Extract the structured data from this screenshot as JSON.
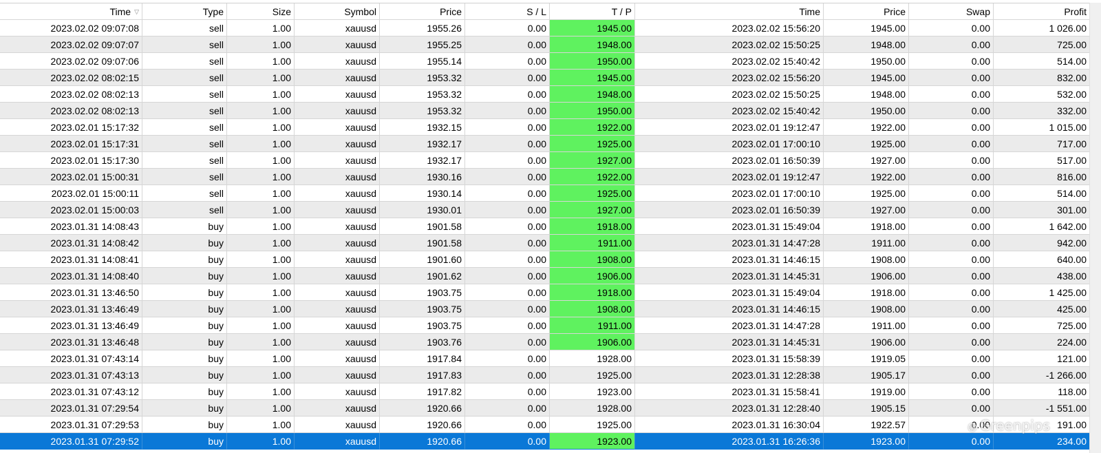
{
  "columns": [
    "Time",
    "Type",
    "Size",
    "Symbol",
    "Price",
    "S / L",
    "T / P",
    "Time",
    "Price",
    "Swap",
    "Profit"
  ],
  "sort_icon": "sort-descending-icon",
  "colors": {
    "tp_hit": "#5ff25f",
    "selected_row": "#0a78d7",
    "alt_row": "#ebebeb"
  },
  "watermark": {
    "icon": "wechat-icon",
    "text": "Greenpips"
  },
  "rows": [
    {
      "open_time": "2023.02.02 09:07:08",
      "type": "sell",
      "size": "1.00",
      "symbol": "xauusd",
      "price": "1955.26",
      "sl": "0.00",
      "tp": "1945.00",
      "tp_hit": true,
      "close_time": "2023.02.02 15:56:20",
      "close_price": "1945.00",
      "swap": "0.00",
      "profit": "1 026.00"
    },
    {
      "open_time": "2023.02.02 09:07:07",
      "type": "sell",
      "size": "1.00",
      "symbol": "xauusd",
      "price": "1955.25",
      "sl": "0.00",
      "tp": "1948.00",
      "tp_hit": true,
      "close_time": "2023.02.02 15:50:25",
      "close_price": "1948.00",
      "swap": "0.00",
      "profit": "725.00"
    },
    {
      "open_time": "2023.02.02 09:07:06",
      "type": "sell",
      "size": "1.00",
      "symbol": "xauusd",
      "price": "1955.14",
      "sl": "0.00",
      "tp": "1950.00",
      "tp_hit": true,
      "close_time": "2023.02.02 15:40:42",
      "close_price": "1950.00",
      "swap": "0.00",
      "profit": "514.00"
    },
    {
      "open_time": "2023.02.02 08:02:15",
      "type": "sell",
      "size": "1.00",
      "symbol": "xauusd",
      "price": "1953.32",
      "sl": "0.00",
      "tp": "1945.00",
      "tp_hit": true,
      "close_time": "2023.02.02 15:56:20",
      "close_price": "1945.00",
      "swap": "0.00",
      "profit": "832.00"
    },
    {
      "open_time": "2023.02.02 08:02:13",
      "type": "sell",
      "size": "1.00",
      "symbol": "xauusd",
      "price": "1953.32",
      "sl": "0.00",
      "tp": "1948.00",
      "tp_hit": true,
      "close_time": "2023.02.02 15:50:25",
      "close_price": "1948.00",
      "swap": "0.00",
      "profit": "532.00"
    },
    {
      "open_time": "2023.02.02 08:02:13",
      "type": "sell",
      "size": "1.00",
      "symbol": "xauusd",
      "price": "1953.32",
      "sl": "0.00",
      "tp": "1950.00",
      "tp_hit": true,
      "close_time": "2023.02.02 15:40:42",
      "close_price": "1950.00",
      "swap": "0.00",
      "profit": "332.00"
    },
    {
      "open_time": "2023.02.01 15:17:32",
      "type": "sell",
      "size": "1.00",
      "symbol": "xauusd",
      "price": "1932.15",
      "sl": "0.00",
      "tp": "1922.00",
      "tp_hit": true,
      "close_time": "2023.02.01 19:12:47",
      "close_price": "1922.00",
      "swap": "0.00",
      "profit": "1 015.00"
    },
    {
      "open_time": "2023.02.01 15:17:31",
      "type": "sell",
      "size": "1.00",
      "symbol": "xauusd",
      "price": "1932.17",
      "sl": "0.00",
      "tp": "1925.00",
      "tp_hit": true,
      "close_time": "2023.02.01 17:00:10",
      "close_price": "1925.00",
      "swap": "0.00",
      "profit": "717.00"
    },
    {
      "open_time": "2023.02.01 15:17:30",
      "type": "sell",
      "size": "1.00",
      "symbol": "xauusd",
      "price": "1932.17",
      "sl": "0.00",
      "tp": "1927.00",
      "tp_hit": true,
      "close_time": "2023.02.01 16:50:39",
      "close_price": "1927.00",
      "swap": "0.00",
      "profit": "517.00"
    },
    {
      "open_time": "2023.02.01 15:00:31",
      "type": "sell",
      "size": "1.00",
      "symbol": "xauusd",
      "price": "1930.16",
      "sl": "0.00",
      "tp": "1922.00",
      "tp_hit": true,
      "close_time": "2023.02.01 19:12:47",
      "close_price": "1922.00",
      "swap": "0.00",
      "profit": "816.00"
    },
    {
      "open_time": "2023.02.01 15:00:11",
      "type": "sell",
      "size": "1.00",
      "symbol": "xauusd",
      "price": "1930.14",
      "sl": "0.00",
      "tp": "1925.00",
      "tp_hit": true,
      "close_time": "2023.02.01 17:00:10",
      "close_price": "1925.00",
      "swap": "0.00",
      "profit": "514.00"
    },
    {
      "open_time": "2023.02.01 15:00:03",
      "type": "sell",
      "size": "1.00",
      "symbol": "xauusd",
      "price": "1930.01",
      "sl": "0.00",
      "tp": "1927.00",
      "tp_hit": true,
      "close_time": "2023.02.01 16:50:39",
      "close_price": "1927.00",
      "swap": "0.00",
      "profit": "301.00"
    },
    {
      "open_time": "2023.01.31 14:08:43",
      "type": "buy",
      "size": "1.00",
      "symbol": "xauusd",
      "price": "1901.58",
      "sl": "0.00",
      "tp": "1918.00",
      "tp_hit": true,
      "close_time": "2023.01.31 15:49:04",
      "close_price": "1918.00",
      "swap": "0.00",
      "profit": "1 642.00"
    },
    {
      "open_time": "2023.01.31 14:08:42",
      "type": "buy",
      "size": "1.00",
      "symbol": "xauusd",
      "price": "1901.58",
      "sl": "0.00",
      "tp": "1911.00",
      "tp_hit": true,
      "close_time": "2023.01.31 14:47:28",
      "close_price": "1911.00",
      "swap": "0.00",
      "profit": "942.00"
    },
    {
      "open_time": "2023.01.31 14:08:41",
      "type": "buy",
      "size": "1.00",
      "symbol": "xauusd",
      "price": "1901.60",
      "sl": "0.00",
      "tp": "1908.00",
      "tp_hit": true,
      "close_time": "2023.01.31 14:46:15",
      "close_price": "1908.00",
      "swap": "0.00",
      "profit": "640.00"
    },
    {
      "open_time": "2023.01.31 14:08:40",
      "type": "buy",
      "size": "1.00",
      "symbol": "xauusd",
      "price": "1901.62",
      "sl": "0.00",
      "tp": "1906.00",
      "tp_hit": true,
      "close_time": "2023.01.31 14:45:31",
      "close_price": "1906.00",
      "swap": "0.00",
      "profit": "438.00"
    },
    {
      "open_time": "2023.01.31 13:46:50",
      "type": "buy",
      "size": "1.00",
      "symbol": "xauusd",
      "price": "1903.75",
      "sl": "0.00",
      "tp": "1918.00",
      "tp_hit": true,
      "close_time": "2023.01.31 15:49:04",
      "close_price": "1918.00",
      "swap": "0.00",
      "profit": "1 425.00"
    },
    {
      "open_time": "2023.01.31 13:46:49",
      "type": "buy",
      "size": "1.00",
      "symbol": "xauusd",
      "price": "1903.75",
      "sl": "0.00",
      "tp": "1908.00",
      "tp_hit": true,
      "close_time": "2023.01.31 14:46:15",
      "close_price": "1908.00",
      "swap": "0.00",
      "profit": "425.00"
    },
    {
      "open_time": "2023.01.31 13:46:49",
      "type": "buy",
      "size": "1.00",
      "symbol": "xauusd",
      "price": "1903.75",
      "sl": "0.00",
      "tp": "1911.00",
      "tp_hit": true,
      "close_time": "2023.01.31 14:47:28",
      "close_price": "1911.00",
      "swap": "0.00",
      "profit": "725.00"
    },
    {
      "open_time": "2023.01.31 13:46:48",
      "type": "buy",
      "size": "1.00",
      "symbol": "xauusd",
      "price": "1903.76",
      "sl": "0.00",
      "tp": "1906.00",
      "tp_hit": true,
      "close_time": "2023.01.31 14:45:31",
      "close_price": "1906.00",
      "swap": "0.00",
      "profit": "224.00"
    },
    {
      "open_time": "2023.01.31 07:43:14",
      "type": "buy",
      "size": "1.00",
      "symbol": "xauusd",
      "price": "1917.84",
      "sl": "0.00",
      "tp": "1928.00",
      "tp_hit": false,
      "close_time": "2023.01.31 15:58:39",
      "close_price": "1919.05",
      "swap": "0.00",
      "profit": "121.00"
    },
    {
      "open_time": "2023.01.31 07:43:13",
      "type": "buy",
      "size": "1.00",
      "symbol": "xauusd",
      "price": "1917.83",
      "sl": "0.00",
      "tp": "1925.00",
      "tp_hit": false,
      "close_time": "2023.01.31 12:28:38",
      "close_price": "1905.17",
      "swap": "0.00",
      "profit": "-1 266.00"
    },
    {
      "open_time": "2023.01.31 07:43:12",
      "type": "buy",
      "size": "1.00",
      "symbol": "xauusd",
      "price": "1917.82",
      "sl": "0.00",
      "tp": "1923.00",
      "tp_hit": false,
      "close_time": "2023.01.31 15:58:41",
      "close_price": "1919.00",
      "swap": "0.00",
      "profit": "118.00"
    },
    {
      "open_time": "2023.01.31 07:29:54",
      "type": "buy",
      "size": "1.00",
      "symbol": "xauusd",
      "price": "1920.66",
      "sl": "0.00",
      "tp": "1928.00",
      "tp_hit": false,
      "close_time": "2023.01.31 12:28:40",
      "close_price": "1905.15",
      "swap": "0.00",
      "profit": "-1 551.00"
    },
    {
      "open_time": "2023.01.31 07:29:53",
      "type": "buy",
      "size": "1.00",
      "symbol": "xauusd",
      "price": "1920.66",
      "sl": "0.00",
      "tp": "1925.00",
      "tp_hit": false,
      "close_time": "2023.01.31 16:30:04",
      "close_price": "1922.57",
      "swap": "0.00",
      "profit": "191.00"
    },
    {
      "open_time": "2023.01.31 07:29:52",
      "type": "buy",
      "size": "1.00",
      "symbol": "xauusd",
      "price": "1920.66",
      "sl": "0.00",
      "tp": "1923.00",
      "tp_hit": true,
      "selected": true,
      "close_time": "2023.01.31 16:26:36",
      "close_price": "1923.00",
      "swap": "0.00",
      "profit": "234.00"
    }
  ]
}
